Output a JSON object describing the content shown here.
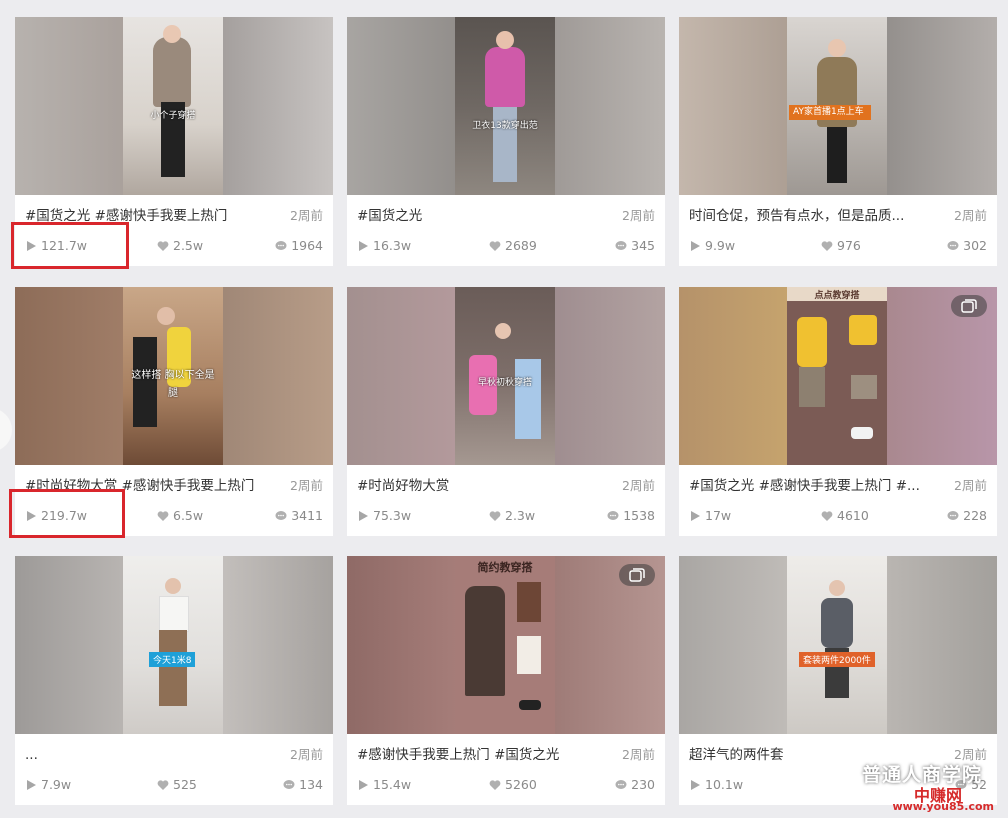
{
  "cards": [
    {
      "title": "#国货之光 #感谢快手我要上热门",
      "time": "2周前",
      "plays": "121.7w",
      "likes": "2.5w",
      "comments": "1964",
      "overlay": "小个子穿搭",
      "badge": ""
    },
    {
      "title": "#国货之光",
      "time": "2周前",
      "plays": "16.3w",
      "likes": "2689",
      "comments": "345",
      "overlay": "卫衣13款穿出范",
      "badge": ""
    },
    {
      "title": "时间仓促，预告有点水，但是品质...",
      "time": "2周前",
      "plays": "9.9w",
      "likes": "976",
      "comments": "302",
      "overlay": "",
      "badge": "AY家首播1点上车"
    },
    {
      "title": "#时尚好物大赏 #感谢快手我要上热门",
      "time": "2周前",
      "plays": "219.7w",
      "likes": "6.5w",
      "comments": "3411",
      "overlay": "这样搭 胸以下全是腿",
      "badge": ""
    },
    {
      "title": "#时尚好物大赏",
      "time": "2周前",
      "plays": "75.3w",
      "likes": "2.3w",
      "comments": "1538",
      "overlay": "早秋初秋穿搭",
      "badge": ""
    },
    {
      "title": "#国货之光 #感谢快手我要上热门 #...",
      "time": "2周前",
      "plays": "17w",
      "likes": "4610",
      "comments": "228",
      "overlay": "点点教穿搭",
      "badge": ""
    },
    {
      "title": "...",
      "time": "2周前",
      "plays": "7.9w",
      "likes": "525",
      "comments": "134",
      "overlay": "",
      "badge": "今天1米8"
    },
    {
      "title": "#感谢快手我要上热门 #国货之光",
      "time": "2周前",
      "plays": "15.4w",
      "likes": "5260",
      "comments": "230",
      "overlay": "简约教穿搭",
      "badge": ""
    },
    {
      "title": "超洋气的两件套",
      "time": "2周前",
      "plays": "10.1w",
      "likes": "",
      "comments": "52",
      "overlay": "",
      "badge": "套装两件2000件"
    }
  ],
  "watermark": {
    "account": "普通人商学院",
    "site": "中赚网",
    "url": "www.you85.com"
  },
  "icons": {
    "play": "play-icon",
    "like": "heart-icon",
    "comment": "comment-icon",
    "multi": "multi-image-icon"
  },
  "colors": {
    "highlight": "#d9262c",
    "page_bg": "#ececef",
    "text_muted": "#999999"
  }
}
